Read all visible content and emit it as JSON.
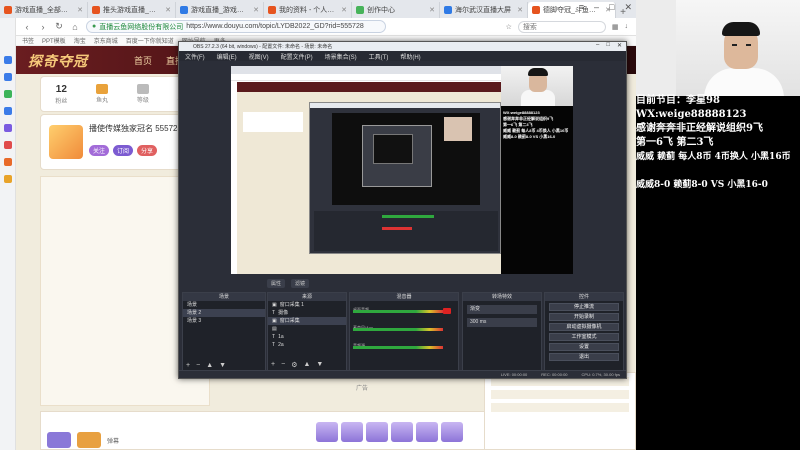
{
  "browser": {
    "tabs": [
      {
        "label": "游戏直播_全部游戏直播_斗鱼直播",
        "active": false
      },
      {
        "label": "推头游戏直播_推头游戏直播视频",
        "active": false
      },
      {
        "label": "游戏直播_游戏直播频道",
        "active": false
      },
      {
        "label": "我的资料 - 个人中心 - 斗鱼",
        "active": false
      },
      {
        "label": "创作中心",
        "active": false
      },
      {
        "label": "海尔武汉直播大屏",
        "active": false
      },
      {
        "label": "德脚夺冠_斗鱼直播平台",
        "active": true
      }
    ],
    "url_host": "直播云鱼网络股份有限公司",
    "url_path": "https://www.douyu.com/topic/LYDB2022_GD?rid=555728",
    "search_placeholder": "搜索",
    "bookmarks": [
      "书签",
      "PPT模板",
      "淘宝",
      "京东商城",
      "百度一下你就知道",
      "网址导航",
      "更多"
    ]
  },
  "page": {
    "logo": "探奇夺冠",
    "nav": [
      "首页",
      "直播",
      "分类"
    ],
    "user_stats": [
      {
        "value": "12",
        "label": "粉丝"
      },
      {
        "value": "",
        "label": "鱼丸"
      },
      {
        "value": "",
        "label": "等级"
      },
      {
        "value": "",
        "label": "任务"
      }
    ],
    "card_title": "播使传媒独家冠名 555728",
    "card_badges": [
      "关注",
      "订阅",
      "分享"
    ],
    "bottom_text": "弹幕",
    "right_panel": [
      "",
      "",
      ""
    ],
    "ad_label": "广告"
  },
  "obs": {
    "title": "OBS 27.2.3 (64 bit, windows) - 配置文件: 未命名 - 场景: 未命名",
    "menu": [
      "文件(F)",
      "编辑(E)",
      "视图(V)",
      "配置文件(P)",
      "场景集合(S)",
      "工具(T)",
      "帮助(H)"
    ],
    "dock_tabs": [
      "属性",
      "滤镜"
    ],
    "scenes": {
      "header": "场景",
      "items": [
        "场景",
        "场景 2",
        "场景 3"
      ]
    },
    "sources": {
      "header": "来源",
      "items": [
        "窗口采集 1",
        "摄像",
        "窗口采集",
        "",
        "1a",
        "2a"
      ]
    },
    "mixer": {
      "header": "混音器",
      "items": [
        "桌面音频",
        "麦克风/Aux",
        "音频源"
      ]
    },
    "transitions": {
      "header": "转场特效",
      "value": "渐变",
      "duration": "300 ms"
    },
    "controls": {
      "header": "控件",
      "buttons": [
        "停止推流",
        "开始录制",
        "启动虚拟摄像机",
        "工作室模式",
        "设置",
        "退出"
      ]
    },
    "status": [
      "LIVE: 00:00:00",
      "REC: 00:00:00",
      "CPU: 0.7%, 30.00 fps"
    ]
  },
  "overlay": {
    "lines": [
      "目前节目：李星98",
      "WX:weige88888123",
      "感谢奔奔非正经解说组织9飞",
      "第一6飞 第二3飞",
      "威威 赖蓟 每人8币 4币换人 小黑16币",
      "",
      "威威8-0 赖蓟8-0 VS 小黑16-0"
    ]
  },
  "preview_overlay": {
    "lines": [
      "WX:weige88888123",
      "感谢奔奔非正经解说组织9飞",
      "第一6飞 第二3飞",
      "威威 赖蓟 每人8币 4币换人 小黑16币",
      "威威8-0 赖蓟8-0 VS 小黑16-0"
    ]
  },
  "colors": {
    "douyu_header": "#5a1a1c",
    "obs_bg": "#2b2e38",
    "overlay_text": "#ffffff",
    "meter_green": "#2fa83e",
    "meter_red": "#dd3333"
  }
}
